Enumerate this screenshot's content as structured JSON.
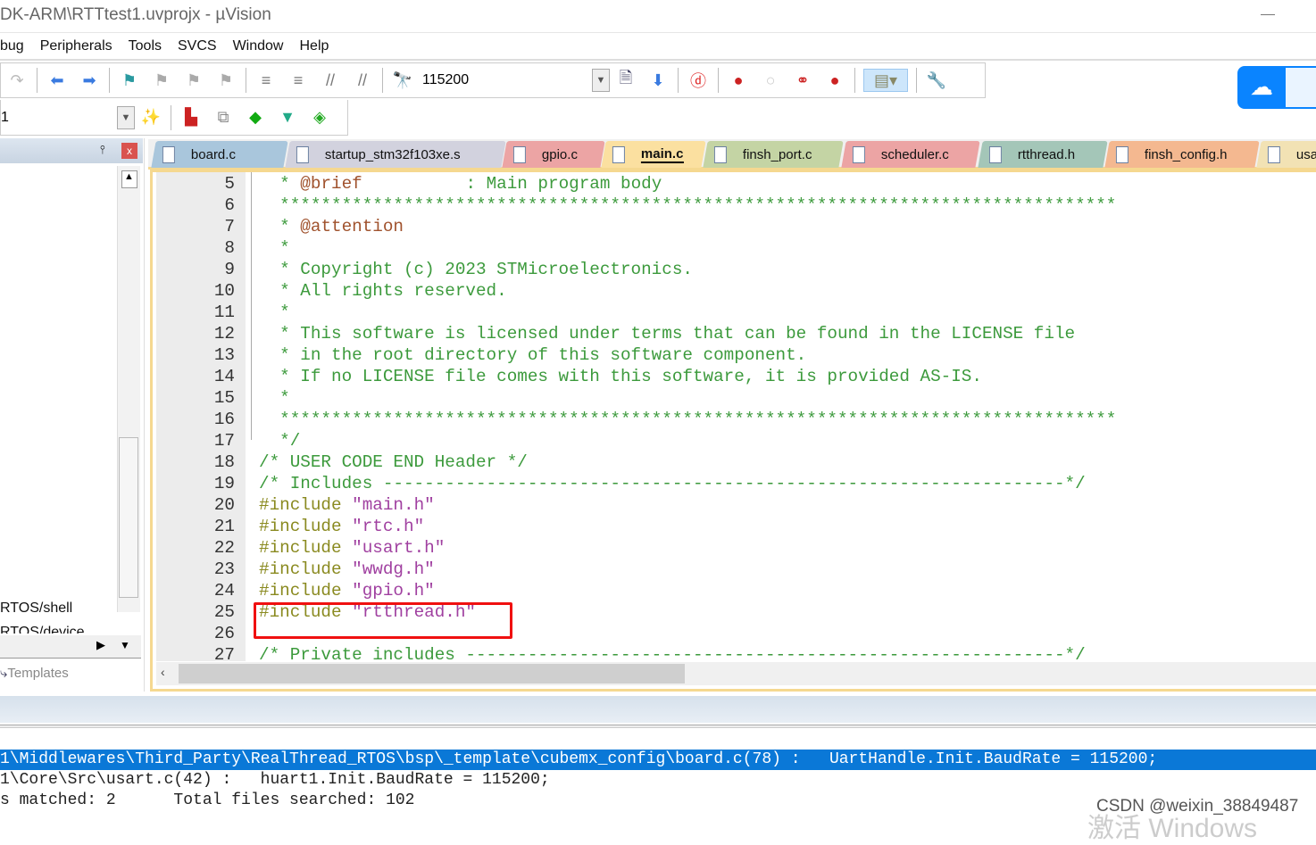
{
  "window": {
    "title": "DK-ARM\\RTTtest1.uvprojx - µVision"
  },
  "menu": [
    "bug",
    "Peripherals",
    "Tools",
    "SVCS",
    "Window",
    "Help"
  ],
  "toolbar": {
    "find_value": "115200",
    "target_value": "1",
    "colors": {
      "breakpoint": "#cc2222",
      "baidu": "#0a84ff"
    }
  },
  "left_panel": {
    "items": [
      "RTOS/shell",
      "RTOS/device"
    ],
    "bottom_tab": "Templates",
    "close": "x",
    "pin": "⫯"
  },
  "tabs": [
    {
      "label": "board.c",
      "color": "#a9c6dc"
    },
    {
      "label": "startup_stm32f103xe.s",
      "color": "#d2d2de"
    },
    {
      "label": "gpio.c",
      "color": "#eca4a4"
    },
    {
      "label": "main.c",
      "color": "#fbe0a0",
      "active": true
    },
    {
      "label": "finsh_port.c",
      "color": "#c4d4a4"
    },
    {
      "label": "scheduler.c",
      "color": "#eca4a4"
    },
    {
      "label": "rtthread.h",
      "color": "#a4c6b8"
    },
    {
      "label": "finsh_config.h",
      "color": "#f4b890"
    },
    {
      "label": "usa",
      "color": "#f2e2b4"
    }
  ],
  "code": [
    {
      "n": "5",
      "seg": [
        [
          "cm",
          "  * "
        ],
        [
          "tag",
          "@brief"
        ],
        [
          "cm",
          "          : Main program body"
        ]
      ]
    },
    {
      "n": "6",
      "seg": [
        [
          "cm",
          "  *********************************************************************************"
        ]
      ]
    },
    {
      "n": "7",
      "seg": [
        [
          "cm",
          "  * "
        ],
        [
          "tag",
          "@attention"
        ]
      ]
    },
    {
      "n": "8",
      "seg": [
        [
          "cm",
          "  *"
        ]
      ]
    },
    {
      "n": "9",
      "seg": [
        [
          "cm",
          "  * Copyright (c) 2023 STMicroelectronics."
        ]
      ]
    },
    {
      "n": "10",
      "seg": [
        [
          "cm",
          "  * All rights reserved."
        ]
      ]
    },
    {
      "n": "11",
      "seg": [
        [
          "cm",
          "  *"
        ]
      ]
    },
    {
      "n": "12",
      "seg": [
        [
          "cm",
          "  * This software is licensed under terms that can be found in the LICENSE file"
        ]
      ]
    },
    {
      "n": "13",
      "seg": [
        [
          "cm",
          "  * in the root directory of this software component."
        ]
      ]
    },
    {
      "n": "14",
      "seg": [
        [
          "cm",
          "  * If no LICENSE file comes with this software, it is provided AS-IS."
        ]
      ]
    },
    {
      "n": "15",
      "seg": [
        [
          "cm",
          "  *"
        ]
      ]
    },
    {
      "n": "16",
      "seg": [
        [
          "cm",
          "  *********************************************************************************"
        ]
      ]
    },
    {
      "n": "17",
      "seg": [
        [
          "cm",
          "  */"
        ]
      ]
    },
    {
      "n": "18",
      "seg": [
        [
          "cm",
          "/* USER CODE END Header */"
        ]
      ]
    },
    {
      "n": "19",
      "seg": [
        [
          "cm",
          "/* Includes ------------------------------------------------------------------*/"
        ]
      ]
    },
    {
      "n": "20",
      "seg": [
        [
          "pp",
          "#include "
        ],
        [
          "str",
          "\"main.h\""
        ]
      ]
    },
    {
      "n": "21",
      "seg": [
        [
          "pp",
          "#include "
        ],
        [
          "str",
          "\"rtc.h\""
        ]
      ]
    },
    {
      "n": "22",
      "seg": [
        [
          "pp",
          "#include "
        ],
        [
          "str",
          "\"usart.h\""
        ]
      ]
    },
    {
      "n": "23",
      "seg": [
        [
          "pp",
          "#include "
        ],
        [
          "str",
          "\"wwdg.h\""
        ]
      ]
    },
    {
      "n": "24",
      "seg": [
        [
          "pp",
          "#include "
        ],
        [
          "str",
          "\"gpio.h\""
        ]
      ]
    },
    {
      "n": "25",
      "seg": [
        [
          "pp",
          "#include "
        ],
        [
          "str",
          "\"rtthread.h\""
        ]
      ]
    },
    {
      "n": "26",
      "seg": []
    },
    {
      "n": "27",
      "seg": [
        [
          "cm",
          "/* Private includes ----------------------------------------------------------*/"
        ]
      ]
    }
  ],
  "output": [
    {
      "text": "1\\Middlewares\\Third_Party\\RealThread_RTOS\\bsp\\_template\\cubemx_config\\board.c(78) :   UartHandle.Init.BaudRate = 115200;",
      "selected": true
    },
    {
      "text": "1\\Core\\Src\\usart.c(42) :   huart1.Init.BaudRate = 115200;"
    },
    {
      "text": "s matched: 2      Total files searched: 102"
    }
  ],
  "watermark": "CSDN @weixin_38849487",
  "watermark2": "激活 Windows"
}
